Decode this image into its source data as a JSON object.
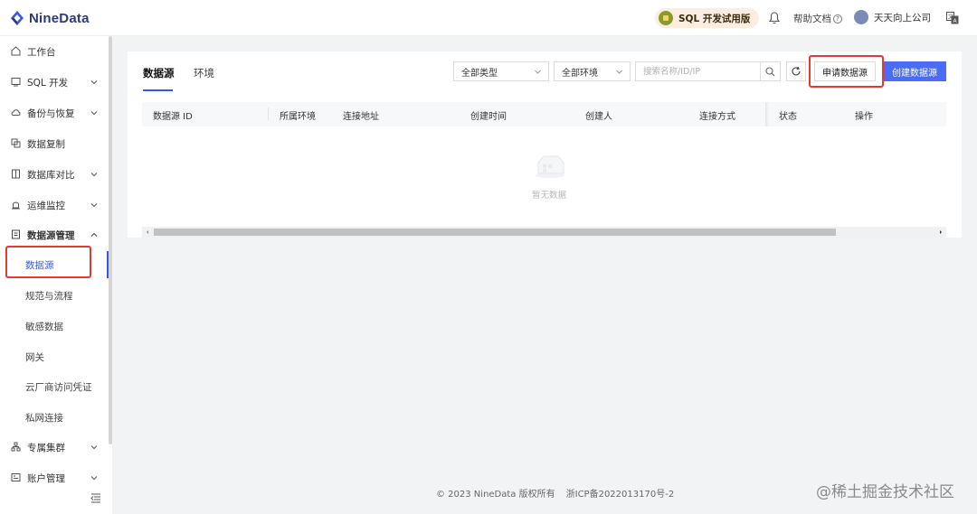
{
  "app": {
    "logo_text": "NineData"
  },
  "header": {
    "trial_label": "SQL 开发试用版",
    "help_label": "帮助文档",
    "help_mark": "?",
    "user_name": "天天向上公司"
  },
  "sidebar": {
    "items": [
      {
        "label": "工作台",
        "icon": "home-icon"
      },
      {
        "label": "SQL 开发",
        "icon": "sql-dev-icon"
      },
      {
        "label": "备份与恢复",
        "icon": "cloud-backup-icon"
      },
      {
        "label": "数据复制",
        "icon": "replication-icon"
      },
      {
        "label": "数据库对比",
        "icon": "compare-icon"
      },
      {
        "label": "运维监控",
        "icon": "alarm-icon"
      },
      {
        "label": "数据源管理",
        "icon": "datasource-icon"
      }
    ],
    "sub_items": [
      {
        "label": "数据源",
        "active": true
      },
      {
        "label": "规范与流程"
      },
      {
        "label": "敏感数据"
      },
      {
        "label": "网关"
      },
      {
        "label": "云厂商访问凭证"
      },
      {
        "label": "私网连接"
      }
    ],
    "bottom_items": [
      {
        "label": "专属集群",
        "icon": "cluster-icon"
      },
      {
        "label": "账户管理",
        "icon": "account-icon"
      }
    ]
  },
  "main": {
    "tabs": [
      {
        "label": "数据源",
        "active": true
      },
      {
        "label": "环境",
        "active": false
      }
    ],
    "filters": {
      "type_select": "全部类型",
      "env_select": "全部环境",
      "search_placeholder": "搜索名称/ID/IP",
      "search_value": ""
    },
    "buttons": {
      "apply_label": "申请数据源",
      "create_label": "创建数据源"
    },
    "table": {
      "columns": [
        "数据源 ID",
        "所属环境",
        "连接地址",
        "创建时间",
        "创建人",
        "连接方式",
        "状态",
        "操作"
      ],
      "rows": [],
      "empty_text": "暂无数据"
    }
  },
  "footer": {
    "copyright": "© 2023 NineData 版权所有",
    "icp": "浙ICP备2022013170号-2"
  },
  "watermark": "@稀土掘金技术社区",
  "colors": {
    "accent": "#4a6cf7",
    "highlight_box": "#e53935",
    "active_nav": "#3a58e8"
  }
}
